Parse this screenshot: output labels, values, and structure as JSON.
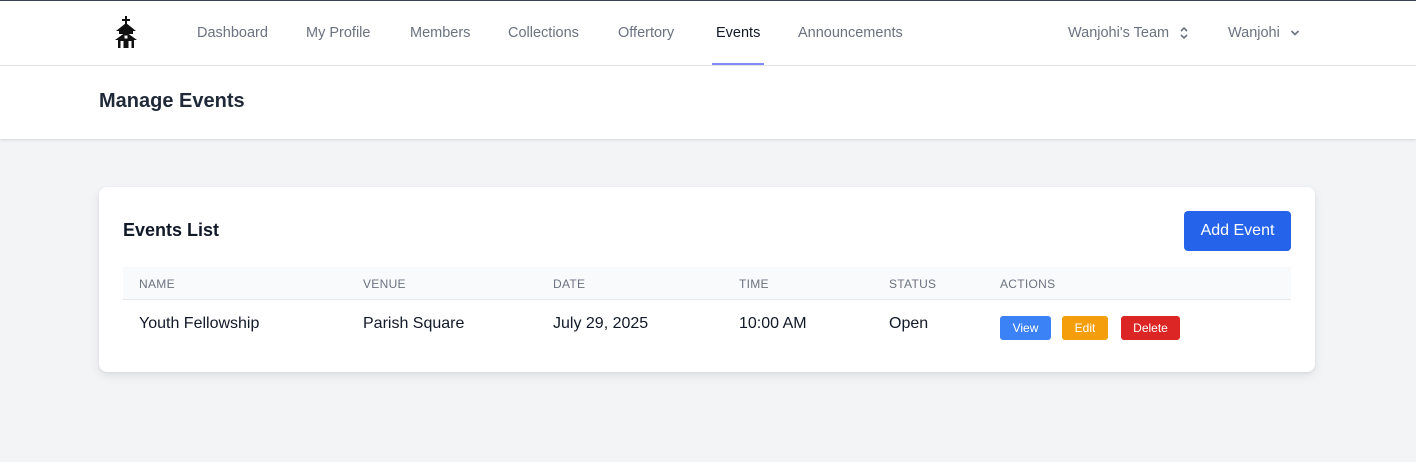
{
  "nav": {
    "items": [
      {
        "label": "Dashboard"
      },
      {
        "label": "My Profile"
      },
      {
        "label": "Members"
      },
      {
        "label": "Collections"
      },
      {
        "label": "Offertory"
      },
      {
        "label": "Events"
      },
      {
        "label": "Announcements"
      }
    ],
    "active": "Events",
    "team": "Wanjohi's Team",
    "user": "Wanjohi"
  },
  "header": {
    "title": "Manage Events"
  },
  "events_card": {
    "title": "Events List",
    "add_button": "Add Event",
    "columns": [
      "NAME",
      "VENUE",
      "DATE",
      "TIME",
      "STATUS",
      "ACTIONS"
    ],
    "rows": [
      {
        "name": "Youth Fellowship",
        "venue": "Parish Square",
        "date": "July 29, 2025",
        "time": "10:00 AM",
        "status": "Open",
        "actions": {
          "view": "View",
          "edit": "Edit",
          "delete": "Delete"
        }
      }
    ]
  },
  "colors": {
    "primary": "#2563eb",
    "view": "#3b82f6",
    "edit": "#f59e0b",
    "delete": "#dc2626",
    "active_tab_underline": "#818cf8"
  },
  "icons": {
    "logo": "church-icon",
    "team_switch": "chevron-up-down-icon",
    "user_menu": "chevron-down-icon"
  }
}
